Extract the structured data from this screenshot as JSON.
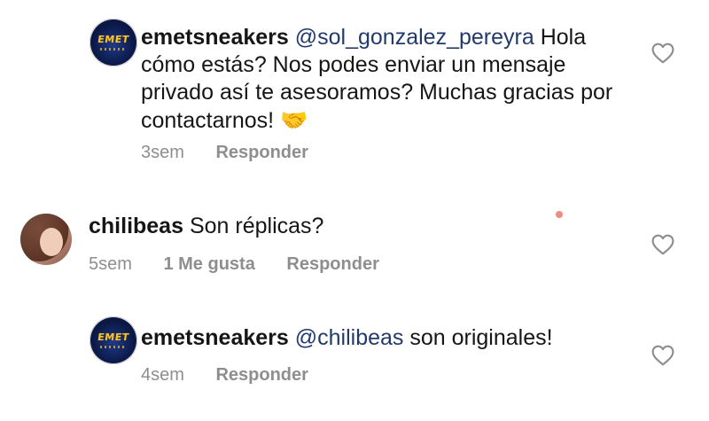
{
  "comments": [
    {
      "username": "emetsneakers",
      "mention": "@sol_gonzalez_pereyra",
      "text": "Hola cómo estás? Nos podes enviar un mensaje privado así te asesoramos? Muchas gracias por contactarnos!",
      "emoji": "🤝",
      "time": "3sem",
      "reply_label": "Responder",
      "avatar_logo_text": "EMET"
    },
    {
      "username": "chilibeas",
      "text": "Son réplicas?",
      "time": "5sem",
      "likes_label": "1 Me gusta",
      "reply_label": "Responder"
    },
    {
      "username": "emetsneakers",
      "mention": "@chilibeas",
      "text": "son originales!",
      "time": "4sem",
      "reply_label": "Responder",
      "avatar_logo_text": "EMET"
    }
  ],
  "icons": {
    "like": "heart-outline-icon"
  },
  "colors": {
    "mention": "#223a6b",
    "meta": "#8e8e8e",
    "notification_dot": "#f28b82"
  }
}
